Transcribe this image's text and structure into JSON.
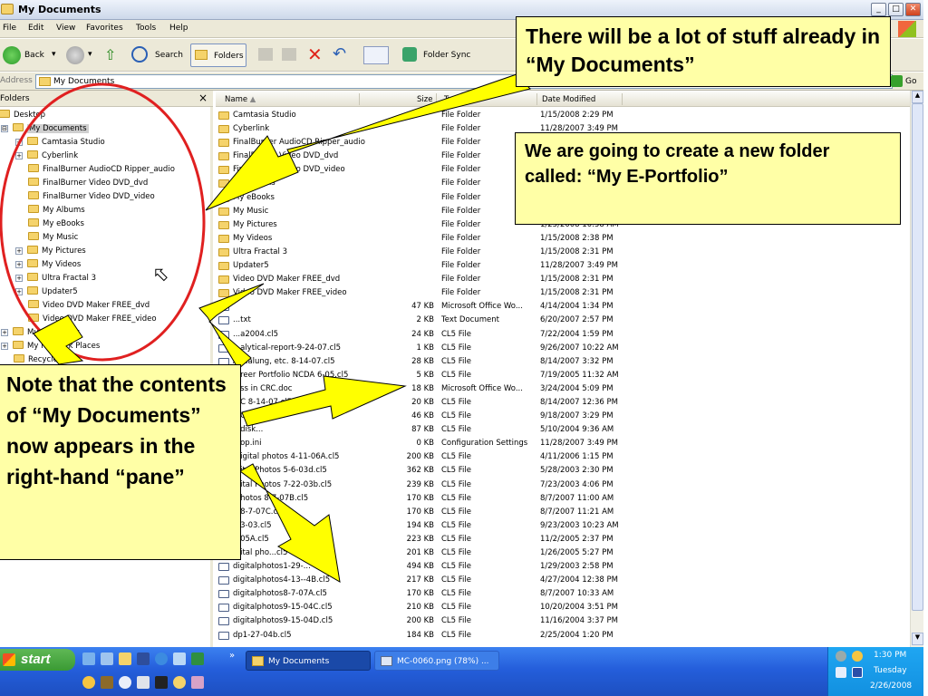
{
  "window": {
    "title": "My Documents",
    "icon": "folder-icon"
  },
  "menus": [
    "File",
    "Edit",
    "View",
    "Favorites",
    "Tools",
    "Help"
  ],
  "toolbar": {
    "back": "Back",
    "search": "Search",
    "folders": "Folders",
    "folder_sync": "Folder Sync"
  },
  "address": {
    "label": "Address",
    "value": "My Documents",
    "go": "Go"
  },
  "folders_pane": {
    "title": "Folders",
    "close": "×",
    "items": [
      {
        "label": "Desktop",
        "expander": "",
        "level": 0
      },
      {
        "label": "My Documents",
        "expander": "⊟",
        "level": 1,
        "selected": true
      },
      {
        "label": "Camtasia Studio",
        "expander": "+",
        "level": 2
      },
      {
        "label": "Cyberlink",
        "expander": "+",
        "level": 2
      },
      {
        "label": "FinalBurner AudioCD Ripper_audio",
        "expander": "",
        "level": 2
      },
      {
        "label": "FinalBurner Video DVD_dvd",
        "expander": "",
        "level": 2
      },
      {
        "label": "FinalBurner Video DVD_video",
        "expander": "",
        "level": 2
      },
      {
        "label": "My Albums",
        "expander": "",
        "level": 2
      },
      {
        "label": "My eBooks",
        "expander": "",
        "level": 2
      },
      {
        "label": "My Music",
        "expander": "",
        "level": 2
      },
      {
        "label": "My Pictures",
        "expander": "+",
        "level": 2
      },
      {
        "label": "My Videos",
        "expander": "+",
        "level": 2
      },
      {
        "label": "Ultra Fractal 3",
        "expander": "+",
        "level": 2
      },
      {
        "label": "Updater5",
        "expander": "+",
        "level": 2
      },
      {
        "label": "Video DVD Maker FREE_dvd",
        "expander": "",
        "level": 2
      },
      {
        "label": "Video DVD Maker FREE_video",
        "expander": "",
        "level": 2
      },
      {
        "label": "My Computer",
        "expander": "+",
        "level": 1
      },
      {
        "label": "My Network Places",
        "expander": "+",
        "level": 1
      },
      {
        "label": "Recycle Bin",
        "expander": "",
        "level": 1
      }
    ]
  },
  "list": {
    "columns": [
      "Name",
      "Size",
      "Type",
      "Date Modified"
    ],
    "rows": [
      {
        "name": "Camtasia Studio",
        "size": "",
        "type": "File Folder",
        "date": "1/15/2008 2:29 PM",
        "icon": "folder"
      },
      {
        "name": "Cyberlink",
        "size": "",
        "type": "File Folder",
        "date": "11/28/2007 3:49 PM",
        "icon": "folder"
      },
      {
        "name": "FinalBurner AudioCD Ripper_audio",
        "size": "",
        "type": "File Folder",
        "date": "",
        "icon": "folder"
      },
      {
        "name": "FinalBurner Video DVD_dvd",
        "size": "",
        "type": "File Folder",
        "date": "",
        "icon": "folder"
      },
      {
        "name": "FinalBurner Video DVD_video",
        "size": "",
        "type": "File Folder",
        "date": "",
        "icon": "folder"
      },
      {
        "name": "My Albums",
        "size": "",
        "type": "File Folder",
        "date": "",
        "icon": "folder"
      },
      {
        "name": "My eBooks",
        "size": "",
        "type": "File Folder",
        "date": "",
        "icon": "folder"
      },
      {
        "name": "My Music",
        "size": "",
        "type": "File Folder",
        "date": "",
        "icon": "folder"
      },
      {
        "name": "My Pictures",
        "size": "",
        "type": "File Folder",
        "date": "1/25/2008 10:58 AM",
        "icon": "folder"
      },
      {
        "name": "My Videos",
        "size": "",
        "type": "File Folder",
        "date": "1/15/2008 2:38 PM",
        "icon": "folder"
      },
      {
        "name": "Ultra Fractal 3",
        "size": "",
        "type": "File Folder",
        "date": "1/15/2008 2:31 PM",
        "icon": "folder"
      },
      {
        "name": "Updater5",
        "size": "",
        "type": "File Folder",
        "date": "11/28/2007 3:49 PM",
        "icon": "folder"
      },
      {
        "name": "Video DVD Maker FREE_dvd",
        "size": "",
        "type": "File Folder",
        "date": "1/15/2008 2:31 PM",
        "icon": "folder"
      },
      {
        "name": "Video DVD Maker FREE_video",
        "size": "",
        "type": "File Folder",
        "date": "1/15/2008 2:31 PM",
        "icon": "folder"
      },
      {
        "name": "",
        "size": "47 KB",
        "type": "Microsoft Office Wo...",
        "date": "4/14/2004 1:34 PM",
        "icon": "file"
      },
      {
        "name": "...txt",
        "size": "2 KB",
        "type": "Text Document",
        "date": "6/20/2007 2:57 PM",
        "icon": "file"
      },
      {
        "name": "...a2004.cl5",
        "size": "24 KB",
        "type": "CL5 File",
        "date": "7/22/2004 1:59 PM",
        "icon": "file"
      },
      {
        "name": "...alytical-report-9-24-07.cl5",
        "size": "1 KB",
        "type": "CL5 File",
        "date": "9/26/2007 10:22 AM",
        "icon": "file"
      },
      {
        "name": "Aqualung, etc. 8-14-07.cl5",
        "size": "28 KB",
        "type": "CL5 File",
        "date": "8/14/2007 3:32 PM",
        "icon": "file"
      },
      {
        "name": "...reer Portfolio NCDA 6-05.cl5",
        "size": "5 KB",
        "type": "CL5 File",
        "date": "7/19/2005 11:32 AM",
        "icon": "file"
      },
      {
        "name": "...ss in CRC.doc",
        "size": "18 KB",
        "type": "Microsoft Office Wo...",
        "date": "3/24/2004 5:09 PM",
        "icon": "file"
      },
      {
        "name": "...C 8-14-07.cl5",
        "size": "20 KB",
        "type": "CL5 File",
        "date": "8/14/2007 12:36 PM",
        "icon": "file"
      },
      {
        "name": "...C C...",
        "size": "46 KB",
        "type": "CL5 File",
        "date": "9/18/2007 3:29 PM",
        "icon": "file"
      },
      {
        "name": "...disk...",
        "size": "87 KB",
        "type": "CL5 File",
        "date": "5/10/2004 9:36 AM",
        "icon": "file"
      },
      {
        "name": "...op.ini",
        "size": "0 KB",
        "type": "Configuration Settings",
        "date": "11/28/2007 3:49 PM",
        "icon": "file"
      },
      {
        "name": "...igital photos 4-11-06A.cl5",
        "size": "200 KB",
        "type": "CL5 File",
        "date": "4/11/2006 1:15 PM",
        "icon": "file"
      },
      {
        "name": "...ital Photos 5-6-03d.cl5",
        "size": "362 KB",
        "type": "CL5 File",
        "date": "5/28/2003 2:30 PM",
        "icon": "file"
      },
      {
        "name": "...ital Photos 7-22-03b.cl5",
        "size": "239 KB",
        "type": "CL5 File",
        "date": "7/23/2003 4:06 PM",
        "icon": "file"
      },
      {
        "name": "...hotos 8-7-07B.cl5",
        "size": "170 KB",
        "type": "CL5 File",
        "date": "8/7/2007 11:00 AM",
        "icon": "file"
      },
      {
        "name": "...8-7-07C.cl5",
        "size": "170 KB",
        "type": "CL5 File",
        "date": "8/7/2007 11:21 AM",
        "icon": "file"
      },
      {
        "name": "...3-03.cl5",
        "size": "194 KB",
        "type": "CL5 File",
        "date": "9/23/2003 10:23 AM",
        "icon": "file"
      },
      {
        "name": "...05A.cl5",
        "size": "223 KB",
        "type": "CL5 File",
        "date": "11/2/2005 2:37 PM",
        "icon": "file"
      },
      {
        "name": "...ital pho...cl5",
        "size": "201 KB",
        "type": "CL5 File",
        "date": "1/26/2005 5:27 PM",
        "icon": "file"
      },
      {
        "name": "digitalphotos1-29-...",
        "size": "494 KB",
        "type": "CL5 File",
        "date": "1/29/2003 2:58 PM",
        "icon": "file"
      },
      {
        "name": "digitalphotos4-13--4B.cl5",
        "size": "217 KB",
        "type": "CL5 File",
        "date": "4/27/2004 12:38 PM",
        "icon": "file"
      },
      {
        "name": "digitalphotos8-7-07A.cl5",
        "size": "170 KB",
        "type": "CL5 File",
        "date": "8/7/2007 10:33 AM",
        "icon": "file"
      },
      {
        "name": "digitalphotos9-15-04C.cl5",
        "size": "210 KB",
        "type": "CL5 File",
        "date": "10/20/2004 3:51 PM",
        "icon": "file"
      },
      {
        "name": "digitalphotos9-15-04D.cl5",
        "size": "200 KB",
        "type": "CL5 File",
        "date": "11/16/2004 3:37 PM",
        "icon": "file"
      },
      {
        "name": "dp1-27-04b.cl5",
        "size": "184 KB",
        "type": "CL5 File",
        "date": "2/25/2004 1:20 PM",
        "icon": "file"
      }
    ]
  },
  "callouts": {
    "top": "There will be a lot of stuff already in “My Documents”",
    "middle": "We are going to create a new folder called:  “My E-Portfolio”",
    "left": "Note that the contents of “My Documents” now appears in the right-hand “pane”"
  },
  "taskbar": {
    "start": "start",
    "tasks": [
      "My Documents",
      "MC-0060.png (78%) ..."
    ],
    "clock": {
      "time": "1:30 PM",
      "day": "Tuesday",
      "date": "2/26/2008"
    }
  },
  "colors": {
    "callout_bg": "#ffffa6",
    "arrow": "#ffff00",
    "highlight_circle": "#e02020"
  }
}
